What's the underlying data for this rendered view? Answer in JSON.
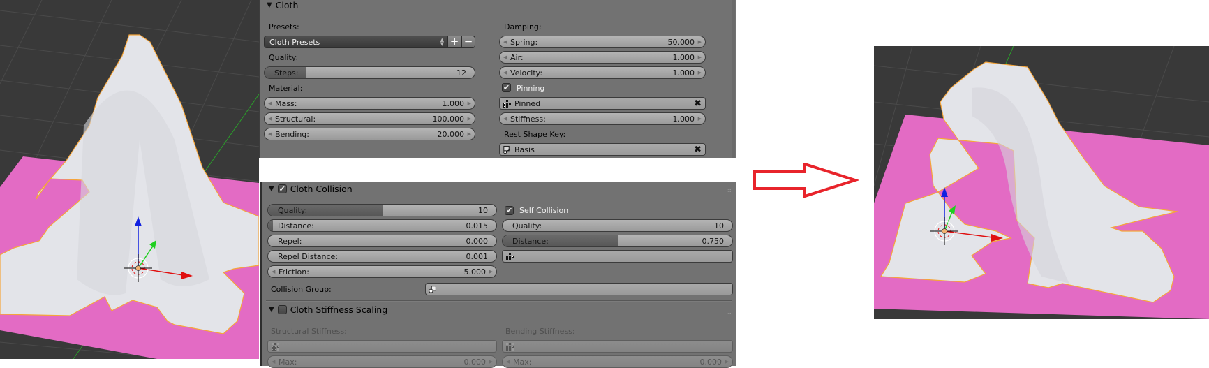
{
  "cloth_panel": {
    "title": "Cloth",
    "presets_label": "Presets:",
    "preset_value": "Cloth Presets",
    "preset_add": "+",
    "preset_remove": "−",
    "quality_label": "Quality:",
    "steps": {
      "name": "Steps:",
      "value": "12",
      "fill": 0.2
    },
    "material_label": "Material:",
    "mass": {
      "name": "Mass:",
      "value": "1.000"
    },
    "structural": {
      "name": "Structural:",
      "value": "100.000"
    },
    "bending": {
      "name": "Bending:",
      "value": "20.000"
    },
    "damping_label": "Damping:",
    "spring": {
      "name": "Spring:",
      "value": "50.000"
    },
    "air": {
      "name": "Air:",
      "value": "1.000"
    },
    "velocity": {
      "name": "Velocity:",
      "value": "1.000"
    },
    "pinning": {
      "label": "Pinning",
      "checked": true
    },
    "pin_group": "Pinned",
    "stiffness": {
      "name": "Stiffness:",
      "value": "1.000"
    },
    "rest_shape_key_label": "Rest Shape Key:",
    "rest_shape_key": "Basis"
  },
  "collision_panel": {
    "title": "Cloth Collision",
    "enabled": true,
    "quality": {
      "name": "Quality:",
      "value": "10",
      "fill": 0.5
    },
    "distance": {
      "name": "Distance:",
      "value": "0.015",
      "fill": 0.02
    },
    "repel": {
      "name": "Repel:",
      "value": "0.000",
      "fill": 0.0
    },
    "repel_distance": {
      "name": "Repel Distance:",
      "value": "0.001",
      "fill": 0.0
    },
    "friction": {
      "name": "Friction:",
      "value": "5.000"
    },
    "self_collision": {
      "label": "Self Collision",
      "checked": true
    },
    "self_quality": {
      "name": "Quality:",
      "value": "10",
      "fill": 0.0
    },
    "self_distance": {
      "name": "Distance:",
      "value": "0.750",
      "fill": 0.5
    },
    "self_vertex_group": "",
    "collision_group_label": "Collision Group:",
    "collision_group": ""
  },
  "stiffness_panel": {
    "title": "Cloth Stiffness Scaling",
    "enabled": false,
    "structural_label": "Structural Stiffness:",
    "bending_label": "Bending Stiffness:",
    "structural_max": {
      "name": "Max:",
      "value": "0.000"
    },
    "bending_max": {
      "name": "Max:",
      "value": "0.000"
    }
  },
  "colors": {
    "panel_bg": "#727272",
    "viewport_bg": "#393939",
    "floor": "#e36bc4",
    "cloth": "#e4e5ea",
    "selection_outline": "#f5a53a",
    "arrow": "#e8242b",
    "axis_x": "#e01010",
    "axis_y": "#20d020",
    "axis_z": "#1020e0"
  },
  "icons": {
    "collapse": "▼",
    "check": "✔",
    "clear": "✖",
    "arrow_left": "◀",
    "arrow_right": "▶",
    "grip": "::::"
  }
}
